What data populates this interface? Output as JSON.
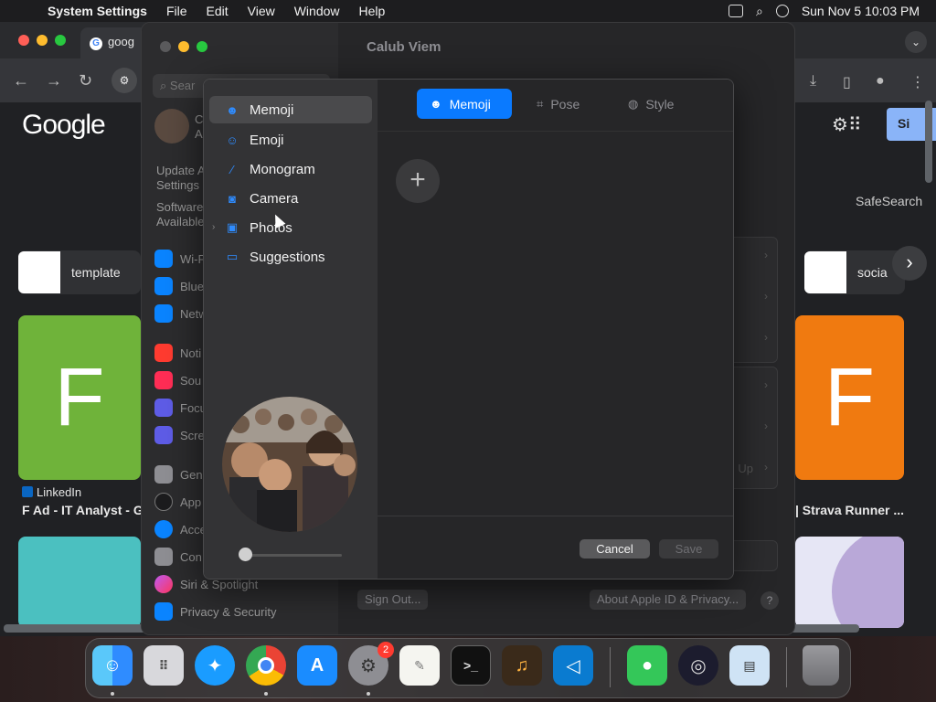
{
  "menubar": {
    "app_name": "System Settings",
    "items": [
      "File",
      "Edit",
      "View",
      "Window",
      "Help"
    ],
    "datetime": "Sun Nov 5  10:03 PM"
  },
  "browser": {
    "tab_title": "goog",
    "logo": "Google",
    "signin": "Si",
    "safesearch": "SafeSearch",
    "chips": [
      "template",
      "socia"
    ],
    "tiles": [
      {
        "letter": "F",
        "color": "#6fb33a",
        "source": "LinkedIn",
        "title": "F Ad - IT Analyst - Go"
      },
      {
        "letter": "F",
        "color": "#f07a10",
        "source": "",
        "title": "| Strava Runner ..."
      }
    ]
  },
  "settings": {
    "window_title": "Calub Viem",
    "search_placeholder": "Sear",
    "profile_initial": "C",
    "profile_sub": "A",
    "update_text": "Update A",
    "update_text2": "Settings",
    "software_text": "Software",
    "software_text2": "Available",
    "sidebar": [
      {
        "label": "Wi-F",
        "color": "#0a84ff"
      },
      {
        "label": "Blue",
        "color": "#0a84ff"
      },
      {
        "label": "Netw",
        "color": "#0a84ff"
      },
      {
        "label": "Noti",
        "color": "#ff3b30"
      },
      {
        "label": "Sou",
        "color": "#ff2d55"
      },
      {
        "label": "Focu",
        "color": "#5e5ce6"
      },
      {
        "label": "Scre",
        "color": "#5e5ce6"
      },
      {
        "label": "Gen",
        "color": "#8e8e93"
      },
      {
        "label": "App",
        "color": "#1c1c1e"
      },
      {
        "label": "Acce",
        "color": "#0a84ff"
      },
      {
        "label": "Con",
        "color": "#8e8e93"
      },
      {
        "label": "Siri & Spotlight",
        "color": "#bf5af2"
      },
      {
        "label": "Privacy & Security",
        "color": "#0a84ff"
      }
    ],
    "up_label": "Up",
    "signout": "Sign Out...",
    "about": "About Apple ID & Privacy...",
    "help": "?"
  },
  "picker": {
    "nav": [
      {
        "label": "Memoji",
        "icon": "memoji-icon",
        "selected": true
      },
      {
        "label": "Emoji",
        "icon": "emoji-icon",
        "selected": false
      },
      {
        "label": "Monogram",
        "icon": "pencil-icon",
        "selected": false
      },
      {
        "label": "Camera",
        "icon": "camera-icon",
        "selected": false
      },
      {
        "label": "Photos",
        "icon": "photos-icon",
        "selected": false
      },
      {
        "label": "Suggestions",
        "icon": "folder-icon",
        "selected": false
      }
    ],
    "tabs": [
      {
        "label": "Memoji",
        "icon": "memoji-icon",
        "selected": true
      },
      {
        "label": "Pose",
        "icon": "pose-icon",
        "selected": false
      },
      {
        "label": "Style",
        "icon": "palette-icon",
        "selected": false
      }
    ],
    "add_label": "+",
    "zoom": 0,
    "cancel": "Cancel",
    "save": "Save"
  },
  "dock": {
    "apps": [
      "Finder",
      "Launchpad",
      "Safari",
      "Chrome",
      "App Store",
      "System Settings",
      "TextEdit",
      "Terminal",
      "GarageBand",
      "VS Code",
      "Messages",
      "OBS",
      "Preview",
      "Trash"
    ],
    "badge_count": "2"
  }
}
